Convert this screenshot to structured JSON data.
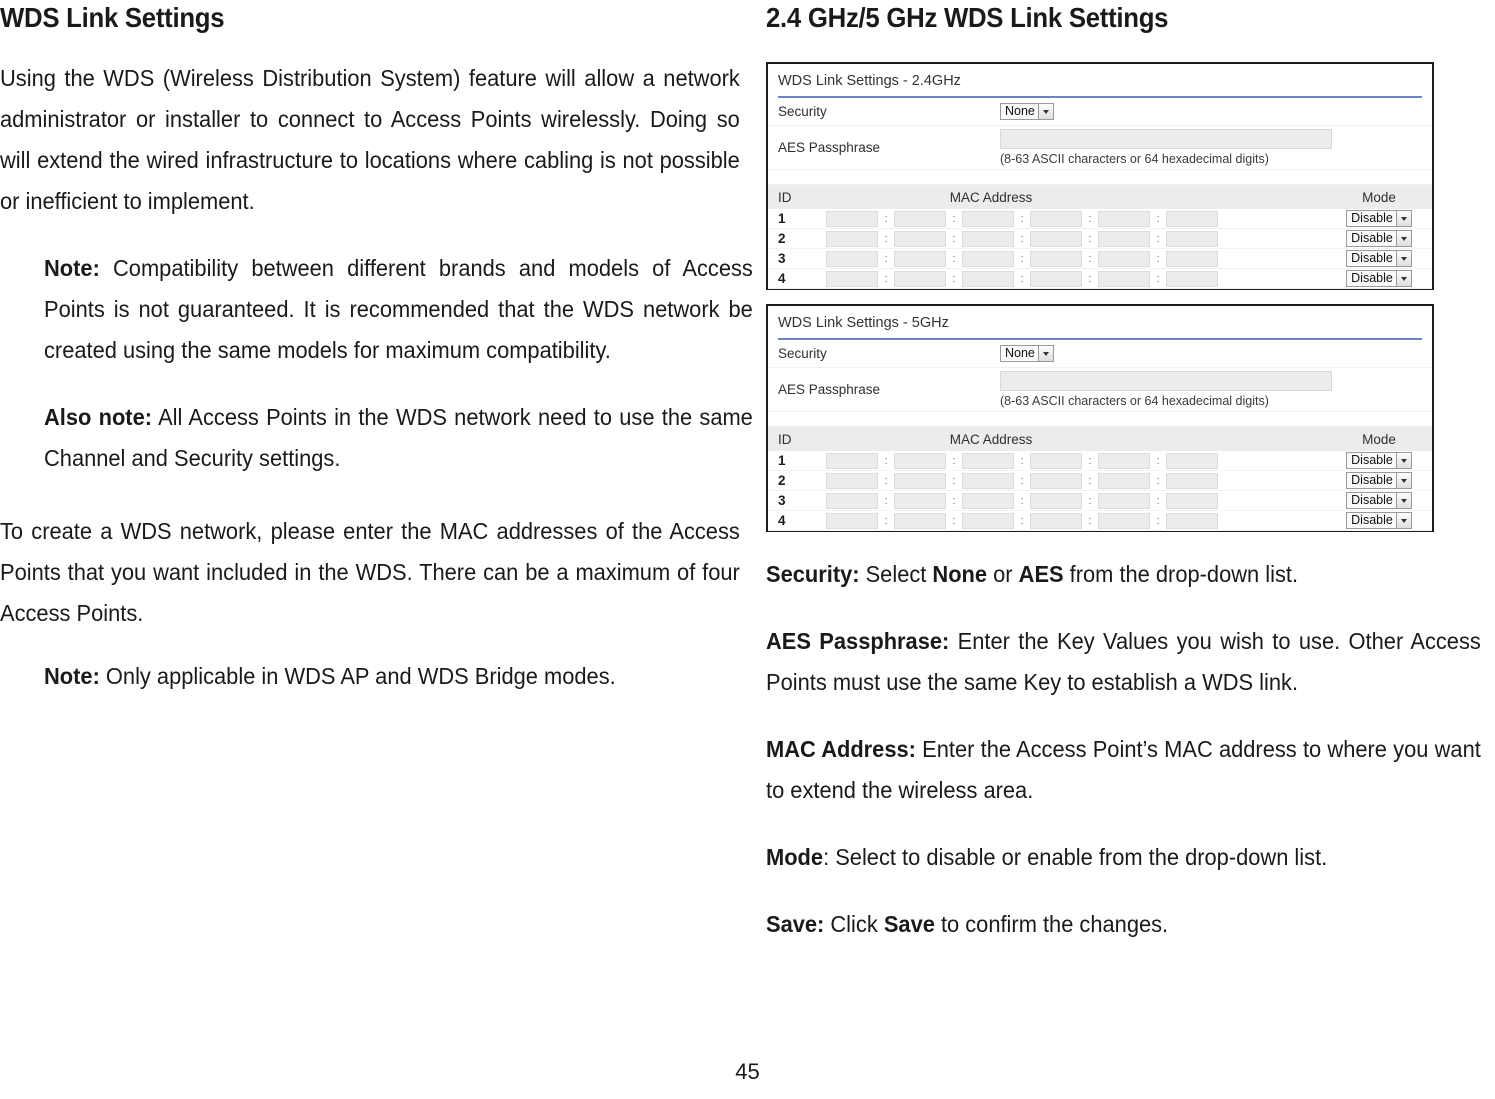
{
  "left_column": {
    "heading": "WDS Link Settings",
    "intro": "Using the WDS (Wireless Distribution System) feature will allow a network administrator or installer to connect to Access Points wirelessly. Doing so will extend the wired infrastructure to locations where cabling is not possible or inefficient to implement.",
    "note_1_label": "Note:",
    "note_1_text": " Compatibility between different brands and models of Access Points is not guaranteed. It is recommended that the WDS network be created using the same models for maximum compatibility.",
    "also_note_label": "Also note:",
    "also_note_text": " All Access Points in the WDS network need to use the same Channel and Security settings.",
    "create_paragraph": "To create a WDS network, please enter the MAC addresses of the Access Points that you want included in the WDS. There can be a maximum of four Access Points.",
    "note_2_label": "Note:",
    "note_2_text": " Only applicable in WDS AP and WDS Bridge modes."
  },
  "right_column": {
    "heading": "2.4 GHz/5 GHz WDS Link Settings",
    "descriptions": {
      "security_label": "Security:",
      "security_text_1": " Select ",
      "security_bold_1": "None",
      "security_text_2": " or ",
      "security_bold_2": "AES",
      "security_text_3": " from the drop-down list.",
      "aes_label": "AES Passphrase:",
      "aes_text": " Enter the Key Values you wish to use. Other Access Points must use the same Key to establish a WDS link.",
      "mac_label": "MAC Address:",
      "mac_text": " Enter the Access Point’s MAC address to where you want to extend the wireless area.",
      "mode_label": "Mode",
      "mode_text": ": Select to disable or enable from the drop-down list.",
      "save_label": "Save:",
      "save_text_1": " Click ",
      "save_bold": "Save",
      "save_text_2": " to confirm the changes."
    }
  },
  "panels": [
    {
      "title": "WDS Link Settings - 2.4GHz",
      "security_label": "Security",
      "security_value": "None",
      "aes_label": "AES Passphrase",
      "aes_value": "",
      "aes_hint": "(8-63 ASCII characters or 64 hexadecimal digits)",
      "columns": {
        "id": "ID",
        "mac": "MAC Address",
        "mode": "Mode"
      },
      "rows": [
        {
          "id": "1",
          "octets": [
            "",
            "",
            "",
            "",
            "",
            ""
          ],
          "mode": "Disable"
        },
        {
          "id": "2",
          "octets": [
            "",
            "",
            "",
            "",
            "",
            ""
          ],
          "mode": "Disable"
        },
        {
          "id": "3",
          "octets": [
            "",
            "",
            "",
            "",
            "",
            ""
          ],
          "mode": "Disable"
        },
        {
          "id": "4",
          "octets": [
            "",
            "",
            "",
            "",
            "",
            ""
          ],
          "mode": "Disable"
        }
      ]
    },
    {
      "title": "WDS Link Settings - 5GHz",
      "security_label": "Security",
      "security_value": "None",
      "aes_label": "AES Passphrase",
      "aes_value": "",
      "aes_hint": "(8-63 ASCII characters or 64 hexadecimal digits)",
      "columns": {
        "id": "ID",
        "mac": "MAC Address",
        "mode": "Mode"
      },
      "rows": [
        {
          "id": "1",
          "octets": [
            "",
            "",
            "",
            "",
            "",
            ""
          ],
          "mode": "Disable"
        },
        {
          "id": "2",
          "octets": [
            "",
            "",
            "",
            "",
            "",
            ""
          ],
          "mode": "Disable"
        },
        {
          "id": "3",
          "octets": [
            "",
            "",
            "",
            "",
            "",
            ""
          ],
          "mode": "Disable"
        },
        {
          "id": "4",
          "octets": [
            "",
            "",
            "",
            "",
            "",
            ""
          ],
          "mode": "Disable"
        }
      ]
    }
  ],
  "footer": {
    "page_number": "45"
  },
  "colors": {
    "panel_border": "#1d1d1d",
    "panel_rule": "#6a82c8",
    "header_row_bg": "#ececec",
    "input_bg": "#ececec",
    "text": "#1a1a1a"
  }
}
